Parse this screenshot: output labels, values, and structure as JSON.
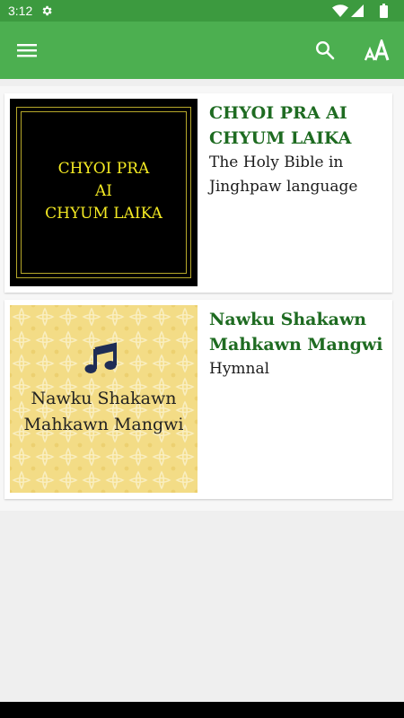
{
  "status_bar": {
    "time": "3:12",
    "icons": [
      "gear-icon",
      "wifi-icon",
      "signal-icon",
      "battery-icon"
    ]
  },
  "app_bar": {
    "color": "#4caf50",
    "icons": [
      "menu-icon",
      "search-icon",
      "font-size-icon"
    ],
    "font_icon_text": "AA"
  },
  "books": [
    {
      "title": "CHYOI PRA AI CHYUM LAIKA",
      "subtitle": "The Holy Bible in Jinghpaw language",
      "cover_lines": [
        "CHYOI PRA",
        "AI",
        "CHYUM LAIKA"
      ]
    },
    {
      "title": "Nawku Shakawn Mahkawn Mangwi",
      "subtitle": "Hymnal",
      "cover_lines": [
        "Nawku Shakawn",
        "Mahkawn Mangwi"
      ]
    }
  ],
  "colors": {
    "title": "#1e6b21",
    "status_bar": "#3c9a3f",
    "bible_cover_text": "#f4ea23",
    "hymn_cover_bg": "#f3dc86"
  }
}
